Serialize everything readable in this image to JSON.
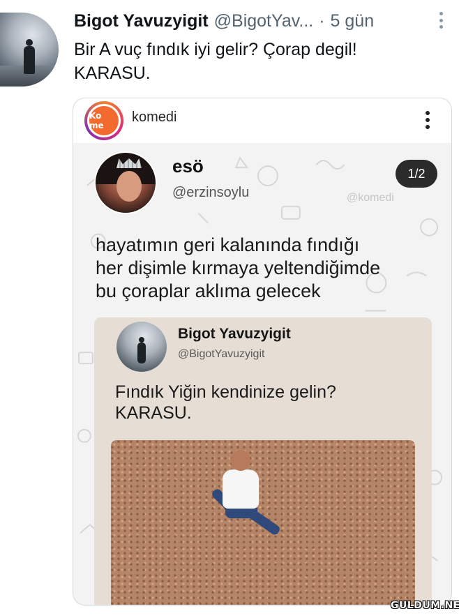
{
  "tweet": {
    "author_name": "Bigot Yavuzyigit",
    "author_handle": "@BigotYav...",
    "separator": "·",
    "time": "5 gün",
    "text": "Bir A vuç fındık iyi gelir? Çorap degil!\nKARASU."
  },
  "embed": {
    "account_name": "komedi",
    "logo_text": "Ko me",
    "post": {
      "author_name": "esö",
      "author_handle": "@erzinsoylu",
      "page_indicator": "1/2",
      "watermark": "@komedi",
      "text": "hayatımın geri kalanında fındığı\nher dişimle kırmaya yeltendiğimde\nbu çoraplar aklıma gelecek",
      "quoted": {
        "author_name": "Bigot Yavuzyigit",
        "author_handle": "@BigotYavuzyigit",
        "text": "Fındık Yiğin kendinize gelin?\nKARASU."
      }
    }
  },
  "site_watermark": "GULDUM.NET"
}
